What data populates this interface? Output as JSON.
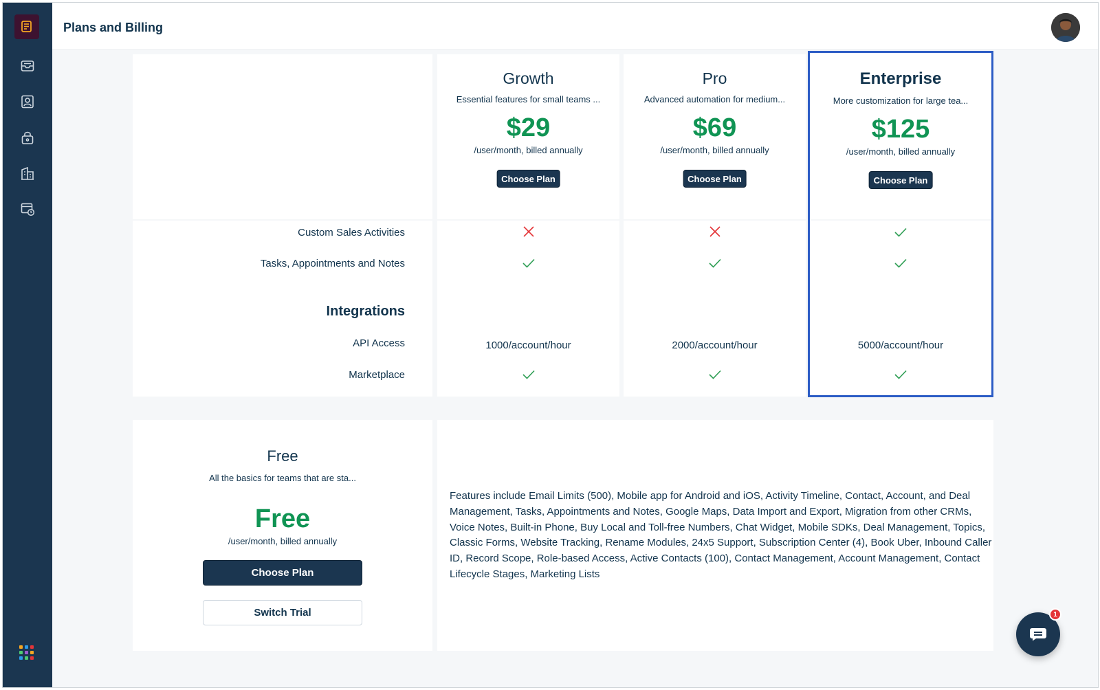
{
  "header": {
    "title": "Plans and Billing"
  },
  "sidebar": {
    "items": [
      {
        "icon": "inbox-icon"
      },
      {
        "icon": "contact-icon"
      },
      {
        "icon": "lock-icon"
      },
      {
        "icon": "building-icon"
      },
      {
        "icon": "calendar-clock-icon"
      }
    ],
    "apps_icon": "apps-grid-icon"
  },
  "plans": [
    {
      "name": "Growth",
      "description": "Essential features for small teams ...",
      "price": "$29",
      "period": "/user/month, billed annually",
      "button": "Choose Plan",
      "features": {
        "custom_sales_activities": false,
        "tasks_appointments_notes": true,
        "api_access": "1000/account/hour",
        "marketplace": true
      }
    },
    {
      "name": "Pro",
      "description": "Advanced automation for medium...",
      "price": "$69",
      "period": "/user/month, billed annually",
      "button": "Choose Plan",
      "features": {
        "custom_sales_activities": false,
        "tasks_appointments_notes": true,
        "api_access": "2000/account/hour",
        "marketplace": true
      }
    },
    {
      "name": "Enterprise",
      "description": "More customization for large tea...",
      "price": "$125",
      "period": "/user/month, billed annually",
      "button": "Choose Plan",
      "highlighted": true,
      "features": {
        "custom_sales_activities": true,
        "tasks_appointments_notes": true,
        "api_access": "5000/account/hour",
        "marketplace": true
      }
    }
  ],
  "feature_rows": {
    "custom_sales_activities": "Custom Sales Activities",
    "tasks_appointments_notes": "Tasks, Appointments and Notes",
    "integrations_heading": "Integrations",
    "api_access": "API Access",
    "marketplace": "Marketplace"
  },
  "free_plan": {
    "name": "Free",
    "description": "All the basics for teams that are sta...",
    "price": "Free",
    "period": "/user/month, billed annually",
    "choose_button": "Choose Plan",
    "trial_button": "Switch Trial",
    "features_text": "Features include Email Limits (500), Mobile app for Android and iOS, Activity Timeline, Contact, Account, and Deal Management, Tasks, Appointments and Notes, Google Maps, Data Import and Export, Migration from other CRMs, Voice Notes, Built-in Phone, Buy Local and Toll-free Numbers, Chat Widget, Mobile SDKs, Deal Management, Topics, Classic Forms, Website Tracking, Rename Modules, 24x5 Support, Subscription Center (4), Book Uber, Inbound Caller ID, Record Scope, Role-based Access, Active Contacts (100), Contact Management, Account Management, Contact Lifecycle Stages, Marketing Lists"
  },
  "chat": {
    "badge_count": "1"
  },
  "colors": {
    "sidebar": "#1b3650",
    "price_green": "#109454",
    "check_green": "#2e9e54",
    "cross_red": "#e43538",
    "highlight_border": "#2c5cc5"
  }
}
